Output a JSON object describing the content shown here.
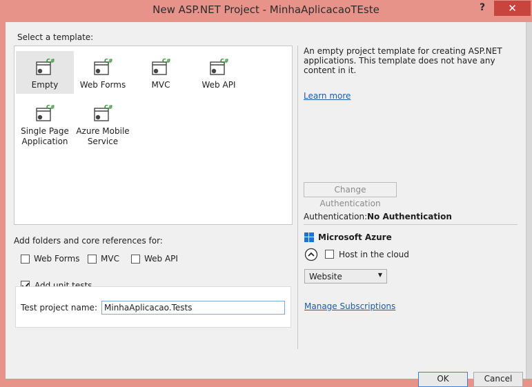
{
  "window": {
    "title": "New ASP.NET Project - MinhaAplicacaoTEste",
    "help_label": "?",
    "close_label": "✕"
  },
  "templates": {
    "heading": "Select a template:",
    "items": [
      {
        "label": "Empty",
        "badge": "C#",
        "selected": true
      },
      {
        "label": "Web Forms",
        "badge": "C#",
        "selected": false
      },
      {
        "label": "MVC",
        "badge": "C#",
        "selected": false
      },
      {
        "label": "Web API",
        "badge": "C#",
        "selected": false
      },
      {
        "label": "Single Page\nApplication",
        "badge": "C#",
        "selected": false
      },
      {
        "label": "Azure Mobile\nService",
        "badge": "C#",
        "selected": false
      }
    ]
  },
  "description": {
    "text": "An empty project template for creating ASP.NET applications. This template does not have any content in it.",
    "learn_more": "Learn more"
  },
  "auth": {
    "change_button": "Change Authentication",
    "label": "Authentication:",
    "value": "No Authentication"
  },
  "azure": {
    "title": "Microsoft Azure",
    "host_label": "Host in the cloud",
    "host_checked": false,
    "target_selected": "Website",
    "manage_link": "Manage Subscriptions"
  },
  "folders": {
    "heading": "Add folders and core references for:",
    "options": [
      {
        "label": "Web Forms",
        "checked": false
      },
      {
        "label": "MVC",
        "checked": false
      },
      {
        "label": "Web API",
        "checked": false
      }
    ]
  },
  "unit_tests": {
    "label": "Add unit tests",
    "checked": true,
    "project_name_label": "Test project name:",
    "project_name_value": "MinhaAplicacao.Tests"
  },
  "footer": {
    "ok_label": "OK",
    "cancel_label": "Cancel"
  },
  "colors": {
    "accent": "#e8938a",
    "close": "#c7453d",
    "link": "#1a5aa8",
    "csharp_badge": "#2e8b2e"
  }
}
